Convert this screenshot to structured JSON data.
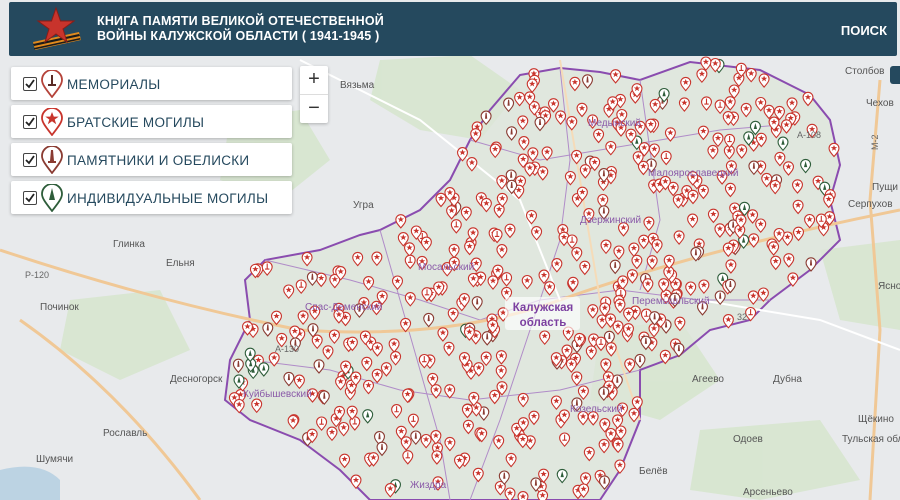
{
  "header": {
    "title_line1": "КНИГА ПАМЯТИ ВЕЛИКОЙ ОТЕЧЕСТВЕННОЙ",
    "title_line2": "ВОЙНЫ КАЛУЖСКОЙ ОБЛАСТИ ( 1941-1945 )",
    "search_label": "ПОИСК",
    "colors": {
      "bar": "#25495e",
      "star": "#c8342c",
      "ribbon_orange": "#e08a1e",
      "ribbon_black": "#1b1b1b"
    }
  },
  "layers": [
    {
      "label": "МЕМОРИАЛЫ",
      "checked": true,
      "icon": "memorial-pin-icon",
      "color": "#b5433a"
    },
    {
      "label": "БРАТСКИЕ МОГИЛЫ",
      "checked": true,
      "icon": "star-pin-icon",
      "color": "#c8342c"
    },
    {
      "label": "ПАМЯТНИКИ И ОБЕЛИСКИ",
      "checked": true,
      "icon": "obelisk-pin-icon",
      "color": "#8a3b32"
    },
    {
      "label": "ИНДИВИДУАЛЬНЫЕ МОГИЛЫ",
      "checked": true,
      "icon": "individual-grave-pin-icon",
      "color": "#2e5d3a"
    }
  ],
  "zoom": {
    "in_label": "+",
    "out_label": "−"
  },
  "map": {
    "region_label_line1": "Калужская",
    "region_label_line2": "область",
    "region_color": "#7b3fa0",
    "places": [
      "Столбов",
      "Чехов",
      "Вязьма",
      "Угра",
      "Глинка",
      "Ельня",
      "Починок",
      "Десногорск",
      "Рославль",
      "Шумячи",
      "Пущи",
      "Серпухов",
      "Ясно",
      "Агеево",
      "Дубна",
      "Щёкино",
      "Одоев",
      "Белёв",
      "Арсеньево",
      "Тульская область"
    ],
    "districts": [
      "Медынский",
      "Малоярославецкий",
      "Дзержинский",
      "Мосальский",
      "Перемышльский",
      "Куйбышевский",
      "Жиздра",
      "Козельский",
      "Спас-Деменский"
    ],
    "roads": [
      "А-108",
      "М-2",
      "А-130",
      "Р-120",
      "32"
    ]
  }
}
